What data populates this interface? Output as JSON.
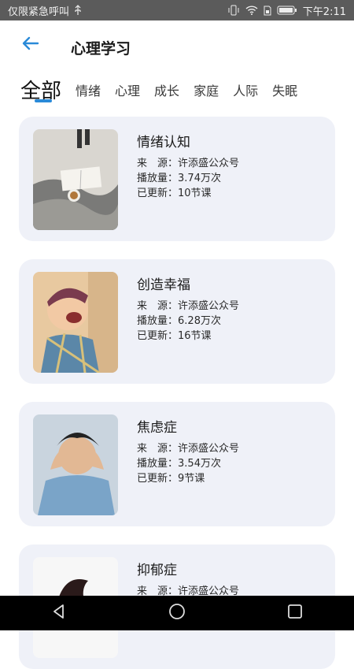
{
  "status_bar": {
    "left_text": "仅限紧急呼叫",
    "time": "下午2:11",
    "icons": [
      "usb-icon",
      "vibrate-icon",
      "wifi-icon",
      "sim-icon",
      "battery-icon"
    ]
  },
  "header": {
    "title": "心理学习",
    "back_icon": "arrow-left-icon"
  },
  "tabs": [
    {
      "label": "全部",
      "active": true
    },
    {
      "label": "情绪"
    },
    {
      "label": "心理"
    },
    {
      "label": "成长"
    },
    {
      "label": "家庭"
    },
    {
      "label": "人际"
    },
    {
      "label": "失眠"
    }
  ],
  "cards": [
    {
      "title": "情绪认知",
      "source_label": "来　源：",
      "source": "许添盛公众号",
      "plays_label": "播放量：",
      "plays": "3.74万次",
      "updated_label": "已更新：",
      "updated": "10节课"
    },
    {
      "title": "创造幸福",
      "source_label": "来　源：",
      "source": "许添盛公众号",
      "plays_label": "播放量：",
      "plays": "6.28万次",
      "updated_label": "已更新：",
      "updated": "16节课"
    },
    {
      "title": "焦虑症",
      "source_label": "来　源：",
      "source": "许添盛公众号",
      "plays_label": "播放量：",
      "plays": "3.54万次",
      "updated_label": "已更新：",
      "updated": "9节课"
    },
    {
      "title": "抑郁症",
      "source_label": "来　源：",
      "source": "许添盛公众号"
    }
  ],
  "colors": {
    "accent": "#2a8ad8",
    "card_bg": "#eff1f8",
    "status_bg": "#5b5b5b"
  }
}
